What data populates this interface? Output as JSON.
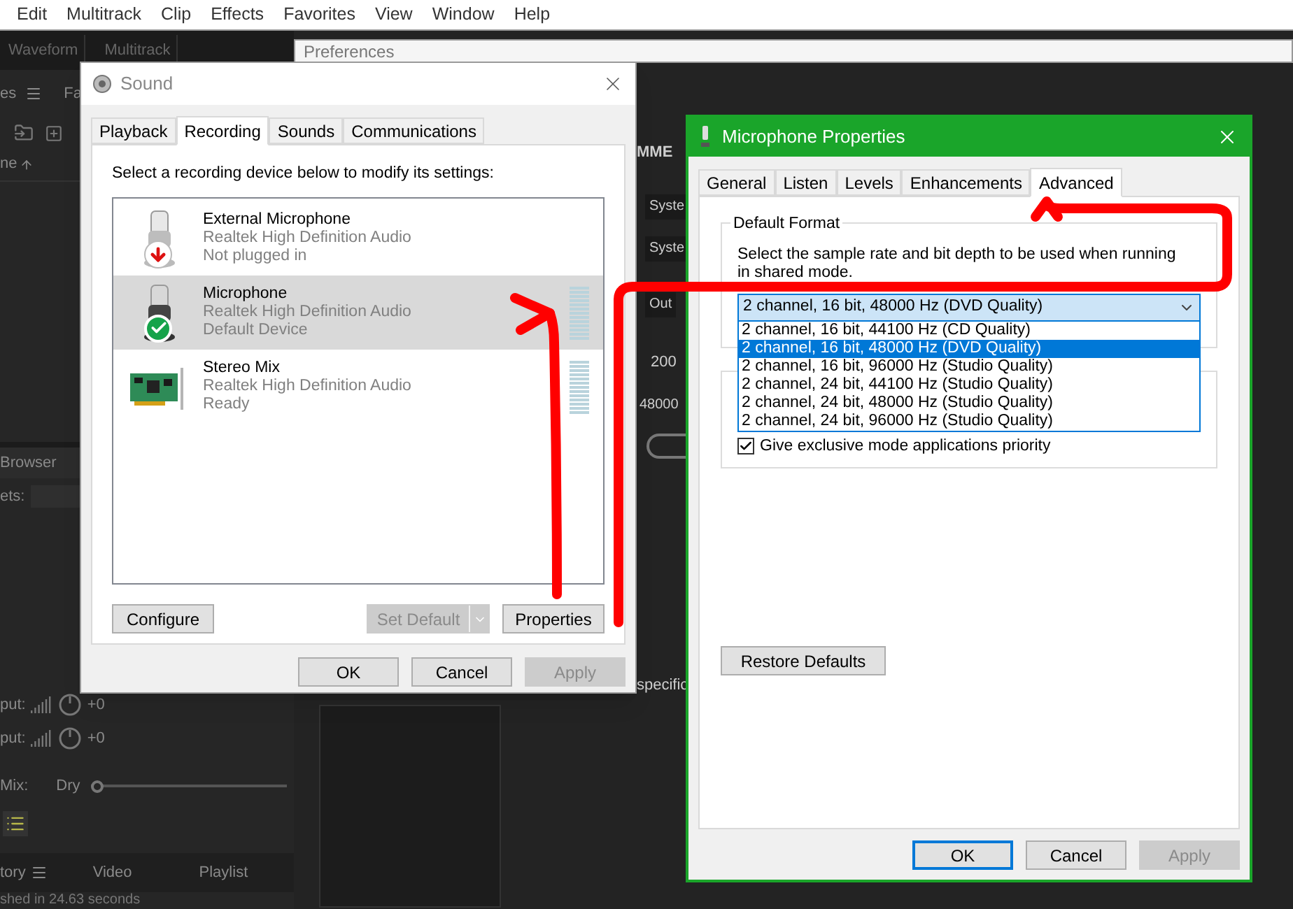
{
  "menu": [
    "Edit",
    "Multitrack",
    "Clip",
    "Effects",
    "Favorites",
    "View",
    "Window",
    "Help"
  ],
  "workspace_tabs": [
    "Waveform",
    "Multitrack"
  ],
  "left_panel": {
    "top_tabs": [
      "es",
      "Fa"
    ],
    "column_header": "ne",
    "browser_title": "Browser",
    "presets_label": "ets:",
    "outputs": [
      {
        "label": "put:",
        "value": "+0"
      },
      {
        "label": "put:",
        "value": "+0"
      }
    ],
    "mix": {
      "label": "Mix:",
      "value": "Dry",
      "level": 0
    },
    "bottom_tabs": [
      "tory",
      "Video",
      "Playlist"
    ],
    "status": "shed in 24.63 seconds"
  },
  "preferences": {
    "title": "Preferences",
    "device_class": "MME",
    "fields": [
      "Syste",
      "Syste",
      "Out"
    ],
    "buffer": "200",
    "sample_rate": "48000",
    "note": "specific"
  },
  "sound_dialog": {
    "title": "Sound",
    "tabs": [
      {
        "label": "Playback",
        "selected": false
      },
      {
        "label": "Recording",
        "selected": true
      },
      {
        "label": "Sounds",
        "selected": false
      },
      {
        "label": "Communications",
        "selected": false
      }
    ],
    "instruction": "Select a recording device below to modify its settings:",
    "devices": [
      {
        "kind": "unplugged_microphone",
        "name": "External Microphone",
        "driver": "Realtek High Definition Audio",
        "status": "Not plugged in",
        "selected": false,
        "meter": false
      },
      {
        "kind": "default_microphone",
        "name": "Microphone",
        "driver": "Realtek High Definition Audio",
        "status": "Default Device",
        "selected": true,
        "meter": true
      },
      {
        "kind": "sound_card",
        "name": "Stereo Mix",
        "driver": "Realtek High Definition Audio",
        "status": "Ready",
        "selected": false,
        "meter": true
      }
    ],
    "configure": "Configure",
    "set_default": {
      "label": "Set Default",
      "disabled": true
    },
    "properties": "Properties",
    "footer": [
      {
        "label": "OK",
        "disabled": false
      },
      {
        "label": "Cancel",
        "disabled": false
      },
      {
        "label": "Apply",
        "disabled": true
      }
    ]
  },
  "mic_properties": {
    "title": "Microphone Properties",
    "tabs": [
      {
        "label": "General",
        "selected": false
      },
      {
        "label": "Listen",
        "selected": false
      },
      {
        "label": "Levels",
        "selected": false
      },
      {
        "label": "Enhancements",
        "selected": false
      },
      {
        "label": "Advanced",
        "selected": true
      }
    ],
    "default_format": {
      "legend": "Default Format",
      "description": "Select the sample rate and bit depth to be used when running in shared mode.",
      "value": "2 channel, 16 bit, 48000 Hz (DVD Quality)",
      "expanded": true,
      "options": [
        {
          "label": "2 channel, 16 bit, 44100 Hz (CD Quality)",
          "selected": false
        },
        {
          "label": "2 channel, 16 bit, 48000 Hz (DVD Quality)",
          "selected": true
        },
        {
          "label": "2 channel, 16 bit, 96000 Hz (Studio Quality)",
          "selected": false
        },
        {
          "label": "2 channel, 24 bit, 44100 Hz (Studio Quality)",
          "selected": false
        },
        {
          "label": "2 channel, 24 bit, 48000 Hz (Studio Quality)",
          "selected": false
        },
        {
          "label": "2 channel, 24 bit, 96000 Hz (Studio Quality)",
          "selected": false
        }
      ]
    },
    "exclusive_priority": {
      "label": "Give exclusive mode applications priority",
      "checked": true
    },
    "restore": "Restore Defaults",
    "footer": [
      {
        "label": "OK",
        "disabled": false,
        "focused": true
      },
      {
        "label": "Cancel",
        "disabled": false,
        "focused": false
      },
      {
        "label": "Apply",
        "disabled": true,
        "focused": false
      }
    ]
  }
}
